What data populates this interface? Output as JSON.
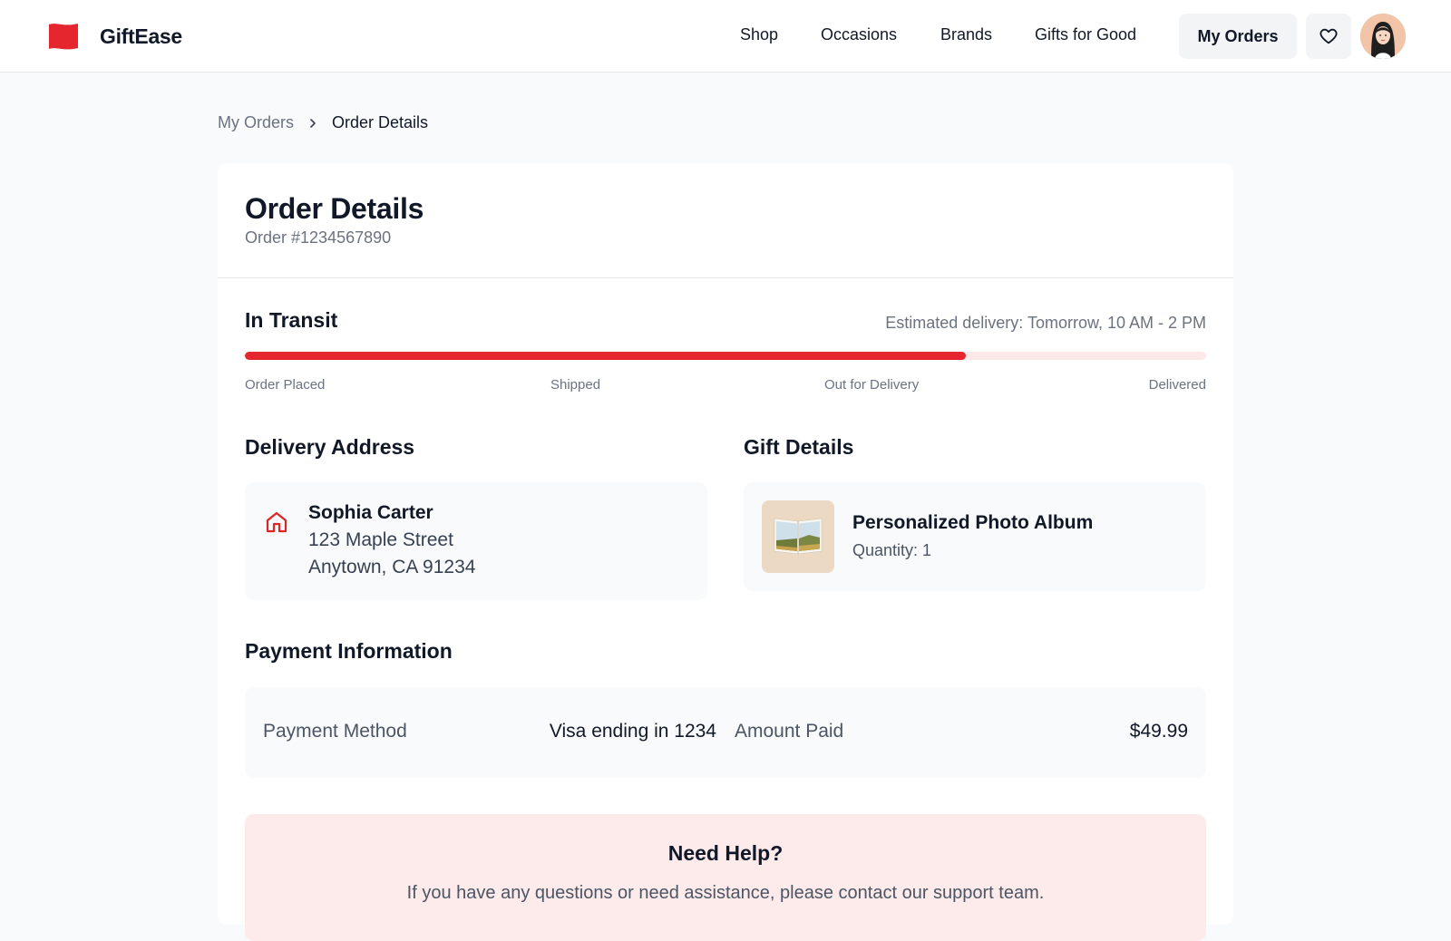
{
  "brand": {
    "name": "GiftEase",
    "color": "#e5262f",
    "logo_icon": "flag-icon"
  },
  "nav": {
    "links": [
      "Shop",
      "Occasions",
      "Brands",
      "Gifts for Good"
    ],
    "orders_button": "My Orders",
    "wishlist_icon": "heart-icon",
    "avatar_icon": "user-avatar"
  },
  "breadcrumb": {
    "parent": "My Orders",
    "current": "Order Details",
    "separator_icon": "chevron-right-icon"
  },
  "order": {
    "title": "Order Details",
    "number": "Order #1234567890",
    "status": "In Transit",
    "eta": "Estimated delivery: Tomorrow, 10 AM - 2 PM",
    "progress_fraction": 0.75,
    "steps": [
      "Order Placed",
      "Shipped",
      "Out for Delivery",
      "Delivered"
    ],
    "active_step_index": 2
  },
  "delivery": {
    "heading": "Delivery Address",
    "icon": "home-icon",
    "name": "Sophia Carter",
    "line1": "123 Maple Street",
    "line2": "Anytown, CA 91234"
  },
  "gift": {
    "heading": "Gift Details",
    "image_icon": "photo-album-image",
    "name": "Personalized Photo Album",
    "quantity": "Quantity: 1"
  },
  "payment": {
    "heading": "Payment Information",
    "method_label": "Payment Method",
    "method_value": "Visa ending in 1234",
    "amount_label": "Amount Paid",
    "amount_value": "$49.99"
  },
  "help": {
    "title": "Need Help?",
    "text": "If you have any questions or need assistance, please contact our support team."
  },
  "colors": {
    "accent": "#e5262f",
    "progress_track": "#fde8e8",
    "help_background": "#fdeaea",
    "page_background": "#f9fafb"
  }
}
